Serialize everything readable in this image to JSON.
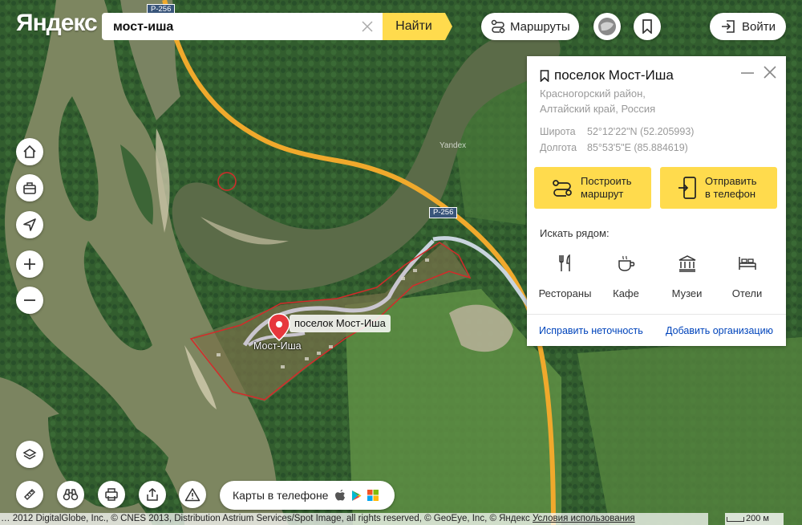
{
  "header": {
    "logo": "Яндекс",
    "search": {
      "value": "мост-иша",
      "find_label": "Найти"
    },
    "routes_label": "Маршруты",
    "login_label": "Войти"
  },
  "panel": {
    "title": "поселок Мост-Иша",
    "region_line1": "Красногорский район,",
    "region_line2": "Алтайский край, Россия",
    "lat_label": "Широта",
    "lat_value": "52°12'22\"N (52.205993)",
    "lon_label": "Долгота",
    "lon_value": "85°53'5\"E (85.884619)",
    "route_button": {
      "line1": "Построить",
      "line2": "маршрут"
    },
    "send_button": {
      "line1": "Отправить",
      "line2": "в телефон"
    },
    "nearby_title": "Искать рядом:",
    "nearby": [
      {
        "label": "Рестораны",
        "icon": "fork-knife-icon"
      },
      {
        "label": "Кафе",
        "icon": "coffee-cup-icon"
      },
      {
        "label": "Музеи",
        "icon": "museum-icon"
      },
      {
        "label": "Отели",
        "icon": "bed-icon"
      }
    ],
    "fix_link": "Исправить неточность",
    "add_org_link": "Добавить организацию"
  },
  "map": {
    "placemark_label": "поселок Мост-Иша",
    "village_name": "Мост-Иша",
    "road_shields": [
      "Р-256",
      "Р-256"
    ],
    "watermark": "Yandex",
    "scale_label": "200 м",
    "colors": {
      "accent": "#ffdb4d",
      "road": "#f0a92c",
      "boundary": "#d42a2a",
      "link": "#04b"
    }
  },
  "footer": {
    "phone_pill_label": "Карты в телефоне",
    "copyright": "… 2012 DigitalGlobe, Inc., © CNES 2013, Distribution Astrium Services/Spot Image, all rights reserved, © GeoEye, Inc, © Яндекс",
    "terms_label": "Условия использования"
  }
}
